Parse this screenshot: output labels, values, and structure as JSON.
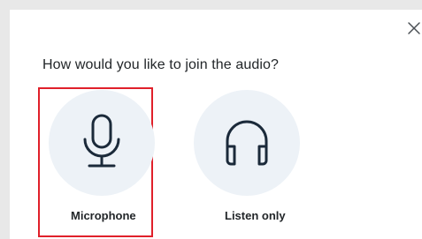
{
  "dialog": {
    "title": "How would you like to join the audio?",
    "close_icon": "close-icon"
  },
  "options": [
    {
      "label": "Microphone",
      "icon": "microphone-icon",
      "selected": true
    },
    {
      "label": "Listen only",
      "icon": "headphones-icon",
      "selected": false
    }
  ],
  "colors": {
    "highlight_border": "#e0202a",
    "circle_bg": "#edf2f7",
    "icon_stroke": "#1b2a3a",
    "text": "#222629"
  }
}
